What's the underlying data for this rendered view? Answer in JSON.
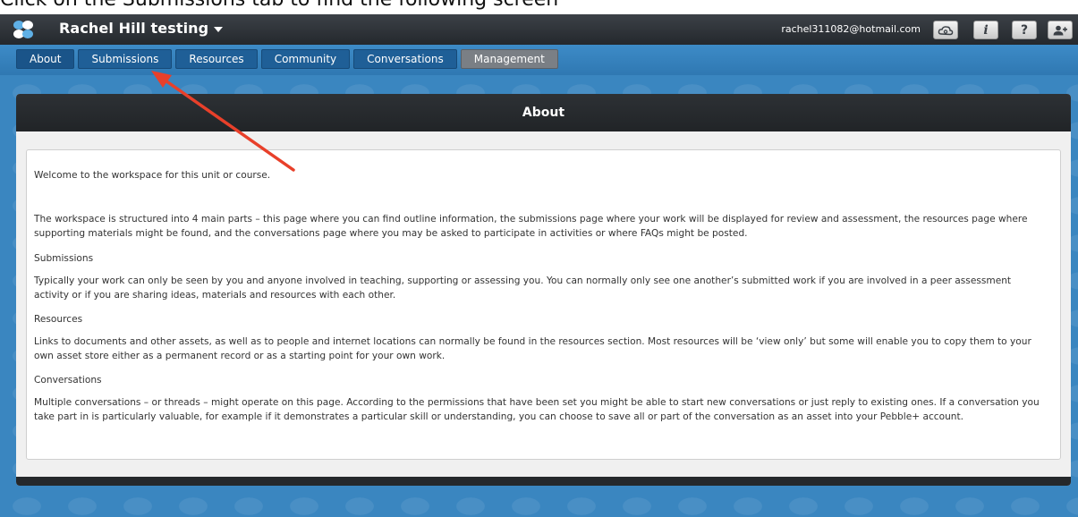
{
  "caption": "Click on the Submissions tab to find the following screen",
  "header": {
    "workspace_title": "Rachel Hill testing",
    "user_email": "rachel311082@hotmail.com",
    "buttons": {
      "cloud_icon": "cloud-sync-icon",
      "info_label": "i",
      "help_label": "?",
      "user_icon": "add-user-icon"
    }
  },
  "tabs": [
    {
      "label": "About"
    },
    {
      "label": "Submissions"
    },
    {
      "label": "Resources"
    },
    {
      "label": "Community"
    },
    {
      "label": "Conversations"
    },
    {
      "label": "Management"
    }
  ],
  "panel": {
    "title": "About",
    "welcome": "Welcome to the workspace for this unit or course.",
    "structure": "The workspace is structured into 4 main parts – this page where you can find outline information, the submissions page where your work will be displayed for review and assessment, the resources page where supporting materials might be found, and the conversations page where you may be asked to participate in activities or where FAQs might be posted.",
    "sections": [
      {
        "heading": "Submissions",
        "body": "Typically your work can only be seen by you and anyone involved in teaching, supporting or assessing you. You can normally only see one another’s submitted work if you are involved in a peer assessment activity or if you are sharing ideas, materials and resources with each other."
      },
      {
        "heading": "Resources",
        "body": "Links to documents and other assets, as well as to people and internet locations can normally be found in the resources section. Most resources will be ‘view only’ but some will enable you to copy them to your own asset store either as a permanent record or as a starting point for your own work."
      },
      {
        "heading": "Conversations",
        "body": "Multiple conversations – or threads – might operate on this page. According to the permissions that have been set you might be able to start new conversations or just reply to existing ones. If a conversation you take part in is particularly valuable, for example if it demonstrates a particular skill or understanding, you can choose to save all or part of the conversation as an asset into your Pebble+ account."
      }
    ]
  },
  "colors": {
    "topbar": "#2b2f34",
    "tabbar": "#3584c0",
    "tab": "#1f5f97",
    "annotation_arrow": "#e8402a"
  }
}
